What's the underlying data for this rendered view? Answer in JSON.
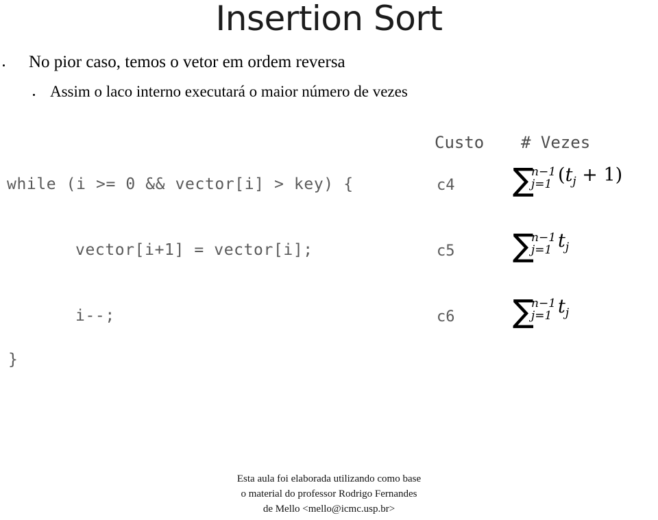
{
  "slide": {
    "title": "Insertion Sort",
    "bullets": [
      {
        "level": 1,
        "text": "No pior caso, temos o vetor em ordem reversa"
      },
      {
        "level": 2,
        "text": "Assim o laco interno executará o maior número de vezes"
      }
    ],
    "table": {
      "headers": {
        "cost": "Custo",
        "times": "# Vezes"
      },
      "rows": [
        {
          "code": "while (i >= 0 && vector[i] > key) {",
          "indent": 0,
          "cost": "c4",
          "times_latex": "\\sum_{j=1}^{n-1}(t_j + 1)",
          "times": {
            "sigma": "∑",
            "upper": "n−1",
            "lower": "j=1",
            "expr_open": "(",
            "expr_var": "t",
            "expr_sub": "j",
            "expr_tail": " + 1)"
          }
        },
        {
          "code": "vector[i+1] = vector[i];",
          "indent": 1,
          "cost": "c5",
          "times_latex": "\\sum_{j=1}^{n-1} t_j",
          "times": {
            "sigma": "∑",
            "upper": "n−1",
            "lower": "j=1",
            "expr_open": "",
            "expr_var": "t",
            "expr_sub": "j",
            "expr_tail": ""
          }
        },
        {
          "code": "i--;",
          "indent": 1,
          "cost": "c6",
          "times_latex": "\\sum_{j=1}^{n-1} t_j",
          "times": {
            "sigma": "∑",
            "upper": "n−1",
            "lower": "j=1",
            "expr_open": "",
            "expr_var": "t",
            "expr_sub": "j",
            "expr_tail": ""
          }
        }
      ],
      "closing_brace": "}"
    },
    "footer": {
      "line1": "Esta aula foi elaborada utilizando como base",
      "line2": "o material do professor Rodrigo Fernandes",
      "line3": "de Mello <mello@icmc.usp.br>"
    },
    "colors": {
      "background": "#ffffff",
      "title": "#1c1c1c",
      "body_text": "#000000",
      "code_text": "#5a5a5a",
      "header_text": "#4c4c4c",
      "formula_text": "#000000"
    }
  }
}
